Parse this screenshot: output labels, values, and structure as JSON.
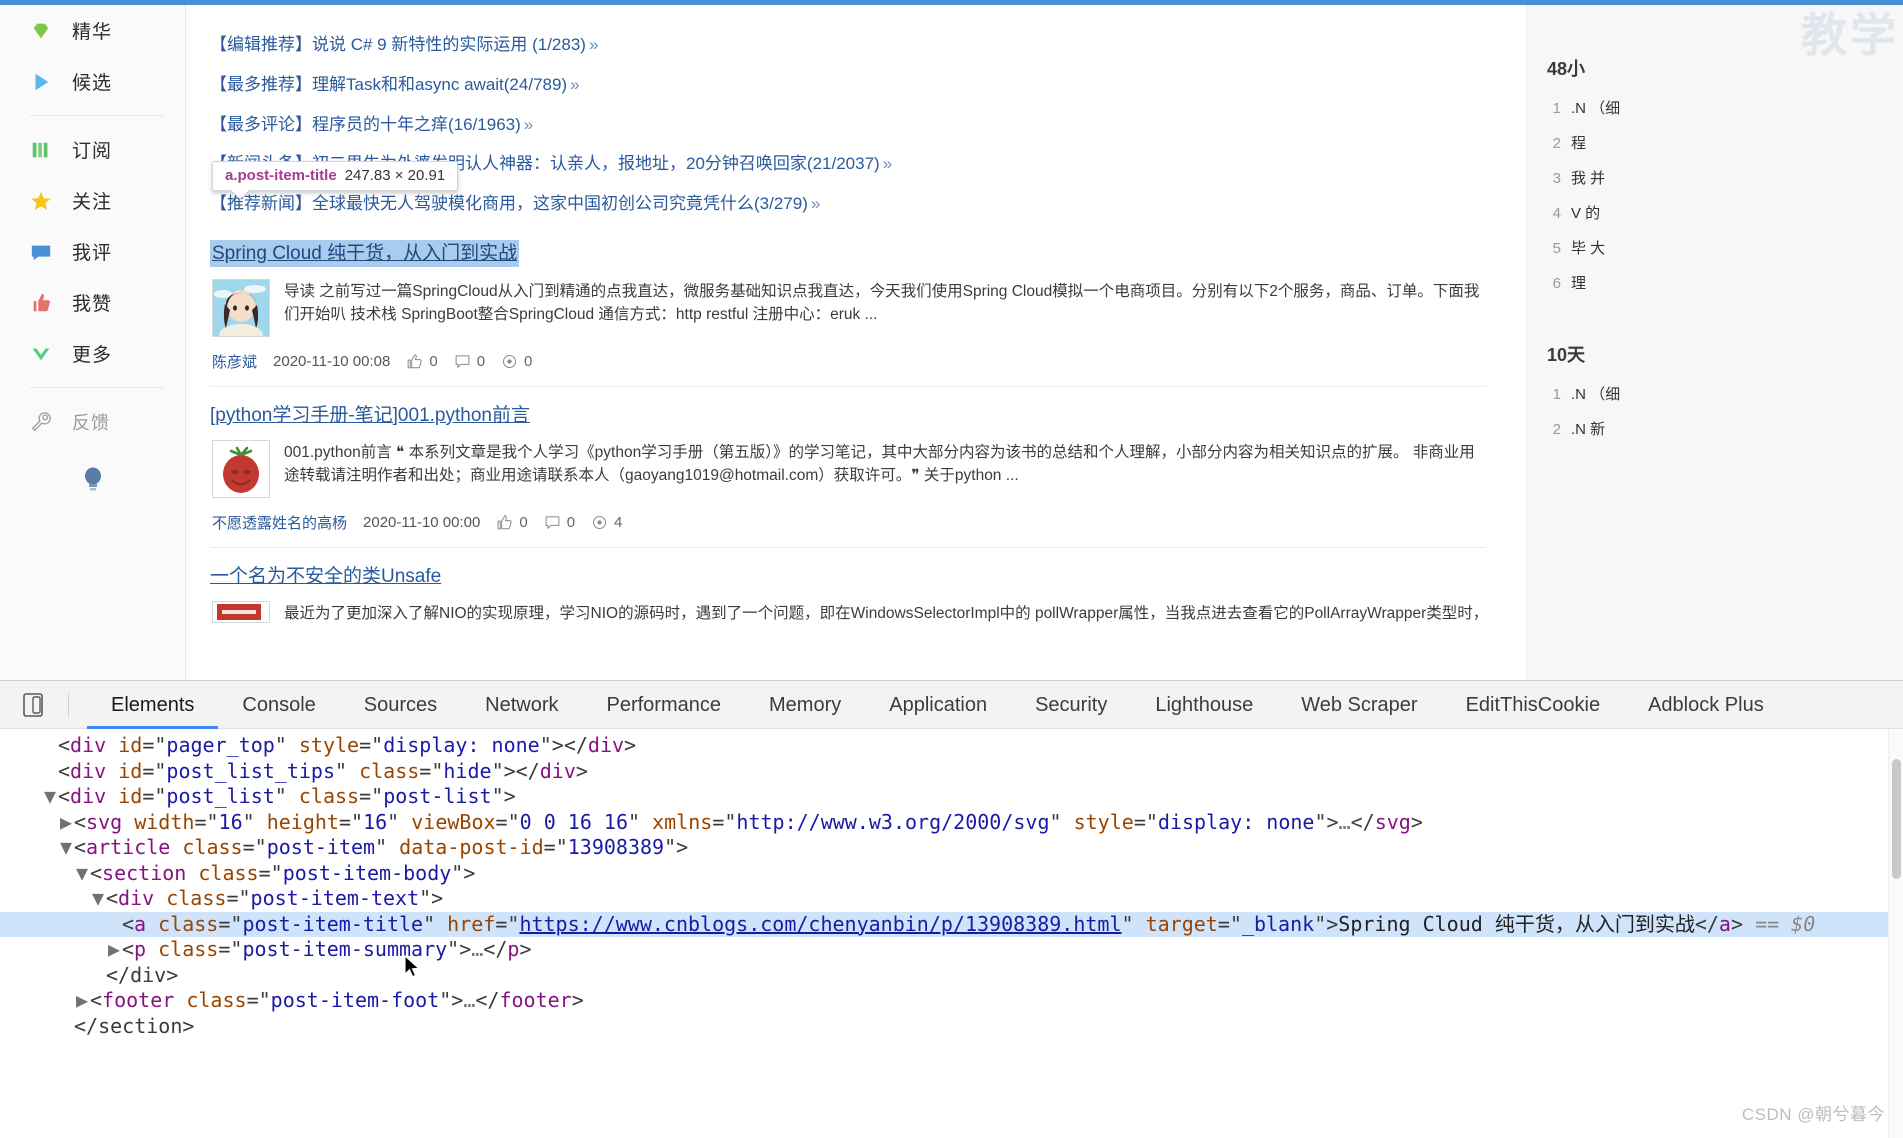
{
  "browser": {
    "accent_color": "#4a8fd4"
  },
  "sidebar": {
    "items": [
      {
        "label": "精华",
        "icon": "gem-icon",
        "color": "#7ec64a",
        "muted": false
      },
      {
        "label": "候选",
        "icon": "play-triangle-icon",
        "color": "#5ab6ef",
        "muted": false
      },
      {
        "label": "订阅",
        "icon": "books-icon",
        "color": "#5ec269",
        "muted": false
      },
      {
        "label": "关注",
        "icon": "star-icon",
        "color": "#f5c518",
        "muted": false
      },
      {
        "label": "我评",
        "icon": "comment-icon",
        "color": "#4a90d9",
        "muted": false
      },
      {
        "label": "我赞",
        "icon": "thumbs-up-icon",
        "color": "#e2736a",
        "muted": false
      },
      {
        "label": "更多",
        "icon": "chevron-down-icon",
        "color": "#4ed07a",
        "muted": false
      },
      {
        "label": "反馈",
        "icon": "wrench-icon",
        "color": "#9b9b9b",
        "muted": true
      }
    ],
    "bulb_icon": "lightbulb-icon",
    "bulb_color": "#5a7ca8"
  },
  "news": [
    {
      "tag": "【编辑推荐】",
      "text": "说说 C# 9 新特性的实际运用 (1/283)",
      "arrow": "»"
    },
    {
      "tag": "【最多推荐】",
      "text": "理解Task和和async await(24/789)",
      "arrow": "»"
    },
    {
      "tag": "【最多评论】",
      "text": "程序员的十年之痒(16/1963)",
      "arrow": "»"
    },
    {
      "tag": "【新闻头条】",
      "text": "初二男生为外婆发明认人神器：认亲人，报地址，20分钟召唤回家(21/2037)",
      "arrow": "»"
    },
    {
      "tag": "【推荐新闻】",
      "text": "全球最快无人驾驶模化商用，这家中国初创公司究竟凭什么(3/279)",
      "arrow": "»"
    }
  ],
  "inspector_tooltip": {
    "selector": "a.post-item-title",
    "dimensions": "247.83 × 20.91"
  },
  "posts": [
    {
      "title": "Spring Cloud 纯干货，从入门到实战",
      "selected": true,
      "thumb": "anime-girl-avatar",
      "summary": "导读 之前写过一篇SpringCloud从入门到精通的点我直达，微服务基础知识点我直达，今天我们使用Spring Cloud模拟一个电商项目。分别有以下2个服务，商品、订单。下面我们开始叭 技术栈 SpringBoot整合SpringCloud 通信方式：http restful 注册中心：eruk ...",
      "author": "陈彦斌",
      "date": "2020-11-10 00:08",
      "likes": "0",
      "comments": "0",
      "views": "0"
    },
    {
      "title": "[python学习手册-笔记]001.python前言",
      "selected": false,
      "thumb": "tomato-avatar",
      "summary": "001.python前言 ❝ 本系列文章是我个人学习《python学习手册（第五版）》的学习笔记，其中大部分内容为该书的总结和个人理解，小部分内容为相关知识点的扩展。 非商业用途转载请注明作者和出处；商业用途请联系本人（gaoyang1019@hotmail.com）获取许可。❞ 关于python ...",
      "author": "不愿透露姓名的高杨",
      "date": "2020-11-10 00:00",
      "likes": "0",
      "comments": "0",
      "views": "4"
    },
    {
      "title": "一个名为不安全的类Unsafe",
      "selected": false,
      "thumb": "red-banner-avatar",
      "summary": "最近为了更加深入了解NIO的实现原理，学习NIO的源码时，遇到了一个问题，即在WindowsSelectorImpl中的 pollWrapper属性，当我点进去查看它的PollArrayWrapper类型时，发现它的",
      "author": "",
      "date": "",
      "likes": "",
      "comments": "",
      "views": ""
    }
  ],
  "right_rail": {
    "watermark": "教学",
    "sections": [
      {
        "heading": "48小",
        "rows": [
          {
            "idx": "1",
            "text": ".N\n（细"
          },
          {
            "idx": "2",
            "text": "程"
          },
          {
            "idx": "3",
            "text": "我\n并"
          },
          {
            "idx": "4",
            "text": "V\n的"
          },
          {
            "idx": "5",
            "text": "毕\n大"
          },
          {
            "idx": "6",
            "text": "理"
          }
        ]
      },
      {
        "heading": "10天",
        "rows": [
          {
            "idx": "1",
            "text": ".N\n（细"
          },
          {
            "idx": "2",
            "text": ".N\n新"
          }
        ]
      }
    ]
  },
  "devtools": {
    "inspect_icon": "device-toolbar-icon",
    "tabs": [
      {
        "label": "Elements",
        "active": true
      },
      {
        "label": "Console",
        "active": false
      },
      {
        "label": "Sources",
        "active": false
      },
      {
        "label": "Network",
        "active": false
      },
      {
        "label": "Performance",
        "active": false
      },
      {
        "label": "Memory",
        "active": false
      },
      {
        "label": "Application",
        "active": false
      },
      {
        "label": "Security",
        "active": false
      },
      {
        "label": "Lighthouse",
        "active": false
      },
      {
        "label": "Web Scraper",
        "active": false
      },
      {
        "label": "EditThisCookie",
        "active": false
      },
      {
        "label": "Adblock Plus",
        "active": false
      }
    ],
    "dom": {
      "line_pager_top": {
        "tag": "div",
        "attr_id": "id",
        "val_id": "pager_top",
        "attr_style": "style",
        "val_style": "display: none"
      },
      "line_post_list_tips": {
        "tag": "div",
        "attr_id": "id",
        "val_id": "post_list_tips",
        "attr_class": "class",
        "val_class": "hide"
      },
      "line_post_list": {
        "tag": "div",
        "attr_id": "id",
        "val_id": "post_list",
        "attr_class": "class",
        "val_class": "post-list"
      },
      "line_svg": {
        "tag": "svg",
        "attr_width": "width",
        "val_width": "16",
        "attr_height": "height",
        "val_height": "16",
        "attr_viewbox": "viewBox",
        "val_viewbox": "0 0 16 16",
        "attr_xmlns": "xmlns",
        "val_xmlns": "http://www.w3.org/2000/svg",
        "attr_style": "style",
        "val_style": "display: none"
      },
      "line_article": {
        "tag": "article",
        "attr_class": "class",
        "val_class": "post-item",
        "attr_postid": "data-post-id",
        "val_postid": "13908389"
      },
      "line_section": {
        "tag": "section",
        "attr_class": "class",
        "val_class": "post-item-body"
      },
      "line_div_text": {
        "tag": "div",
        "attr_class": "class",
        "val_class": "post-item-text"
      },
      "line_anchor": {
        "tag": "a",
        "attr_class": "class",
        "val_class": "post-item-title",
        "attr_href": "href",
        "val_href": "https://www.cnblogs.com/chenyanbin/p/13908389.html",
        "attr_target": "target",
        "val_target": "_blank",
        "text_part1": "Spring Cloud 纯干货，从入",
        "text_part2": "门到实战",
        "console_ref": "== $0"
      },
      "line_p_summary": {
        "tag": "p",
        "attr_class": "class",
        "val_class": "post-item-summary",
        "ellipsis": "…"
      },
      "line_close_div": "</div>",
      "line_footer": {
        "tag": "footer",
        "attr_class": "class",
        "val_class": "post-item-foot",
        "ellipsis": "…"
      },
      "line_close_section": "</section>"
    }
  },
  "watermark_bottom": "CSDN @朝兮暮今"
}
